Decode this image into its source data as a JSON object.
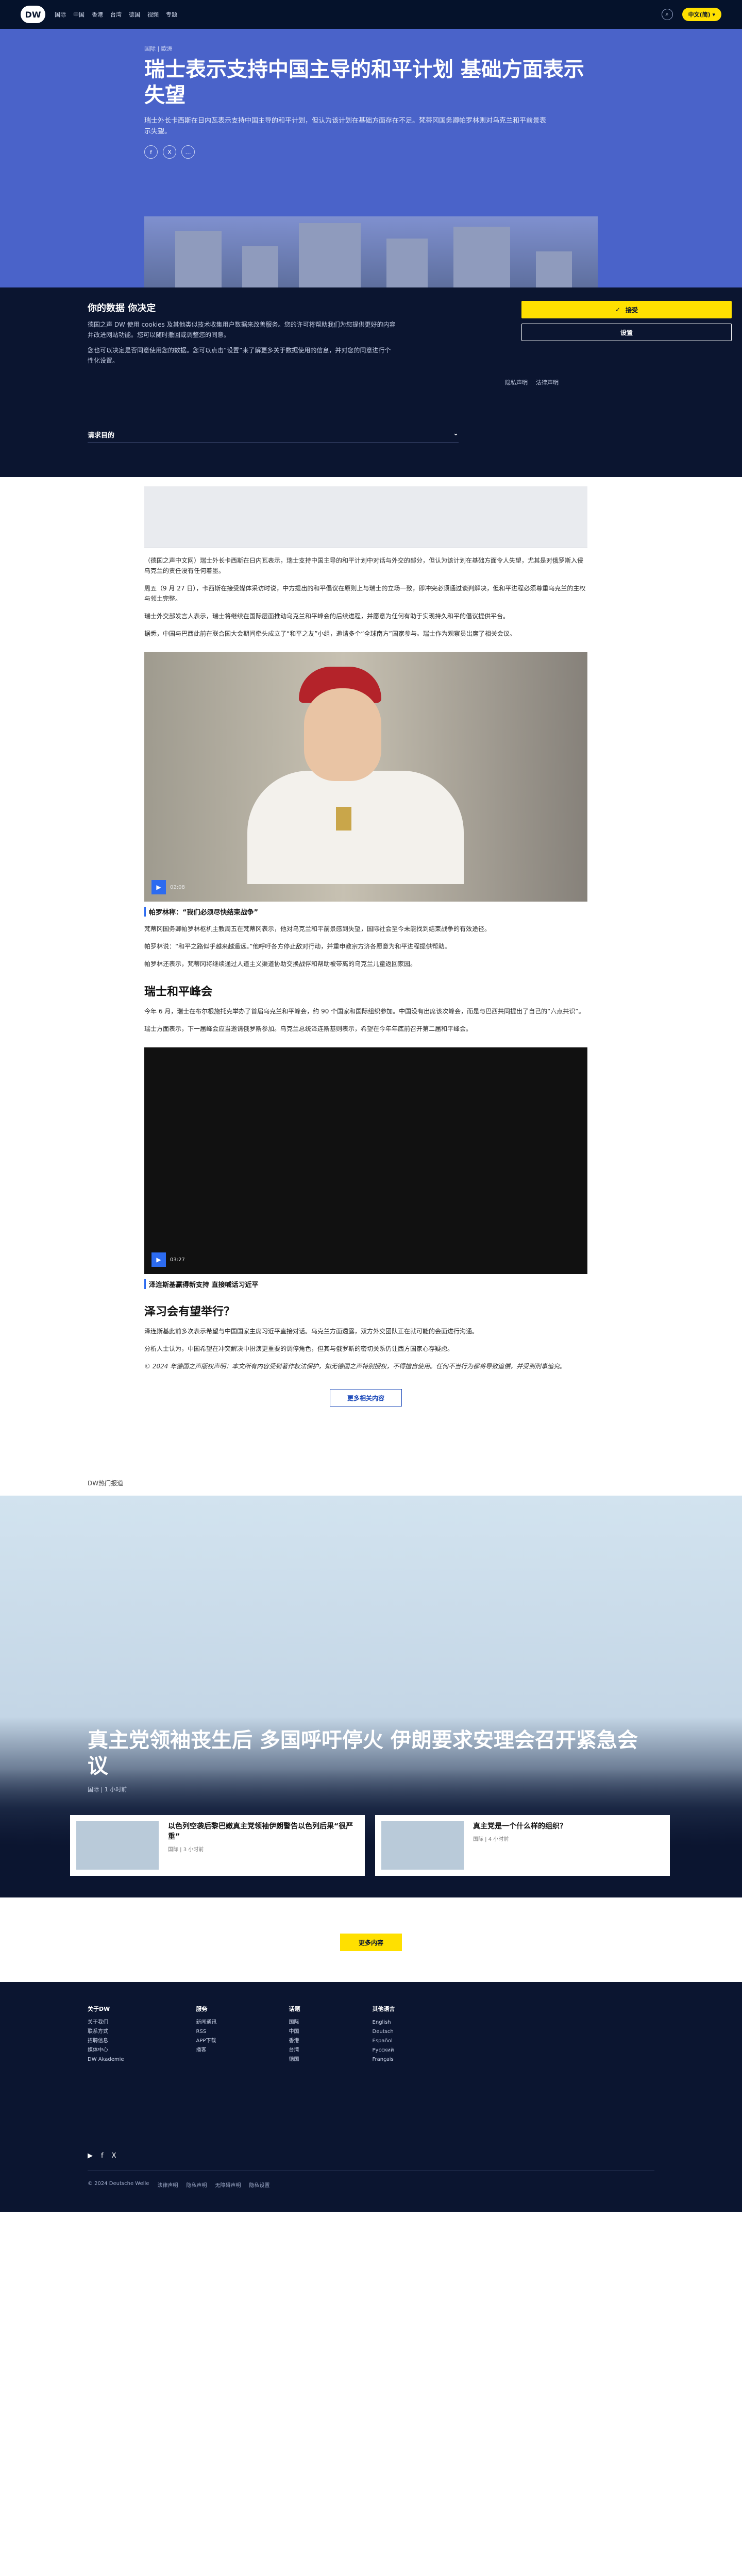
{
  "header": {
    "logo": "DW",
    "nav": [
      "国际",
      "中国",
      "香港",
      "台湾",
      "德国",
      "视频",
      "专题"
    ],
    "search_icon": "search-icon",
    "lang_button": "中文(简) ▾"
  },
  "hero": {
    "kicker": "国际 | 欧洲",
    "title": "瑞士表示支持中国主导的和平计划 基础方面表示失望",
    "lead": "瑞士外长卡西斯在日内瓦表示支持中国主导的和平计划，但认为该计划在基础方面存在不足。梵蒂冈国务卿帕罗林则对乌克兰和平前景表示失望。",
    "share": [
      "f",
      "X",
      "…"
    ]
  },
  "cookie": {
    "title": "你的数据 你决定",
    "text": "德国之声 DW 使用 cookies 及其他类似技术收集用户数据来改善服务。您的许可将帮助我们为您提供更好的内容并改进网站功能。您可以随时撤回或调整您的同意。",
    "text2": "您也可以决定是否同意使用您的数据。您可以点击“设置”来了解更多关于数据使用的信息，并对您的同意进行个性化设置。",
    "accept": "接受",
    "settings": "设置",
    "links": [
      "隐私声明",
      "法律声明"
    ],
    "purpose": "请求目的"
  },
  "article": {
    "ad_label": "",
    "p1": "（德国之声中文网）瑞士外长卡西斯在日内瓦表示，瑞士支持中国主导的和平计划中对话与外交的部分，但认为该计划在基础方面令人失望，尤其是对俄罗斯入侵乌克兰的责任没有任何着墨。",
    "p2": "周五（9 月 27 日），卡西斯在接受媒体采访时说，中方提出的和平倡议在原则上与瑞士的立场一致，即冲突必须通过谈判解决，但和平进程必须尊重乌克兰的主权与领土完整。",
    "p3": "瑞士外交部发言人表示，瑞士将继续在国际层面推动乌克兰和平峰会的后续进程，并愿意为任何有助于实现持久和平的倡议提供平台。",
    "p4": "据悉，中国与巴西此前在联合国大会期间牵头成立了“和平之友”小组，邀请多个“全球南方”国家参与。瑞士作为观察员出席了相关会议。",
    "video1_duration": "02:08",
    "caption1": "帕罗林称：“我们必须尽快结束战争”",
    "p5": "梵蒂冈国务卿帕罗林枢机主教周五在梵蒂冈表示，他对乌克兰和平前景感到失望，国际社会至今未能找到结束战争的有效途径。",
    "p6": "帕罗林说：“和平之路似乎越来越遥远。”他呼吁各方停止敌对行动，并重申教宗方济各愿意为和平进程提供帮助。",
    "p7": "帕罗林还表示，梵蒂冈将继续通过人道主义渠道协助交换战俘和帮助被带离的乌克兰儿童返回家园。",
    "h2a": "瑞士和平峰会",
    "p8": "今年 6 月，瑞士在布尔根施托克举办了首届乌克兰和平峰会，约 90 个国家和国际组织参加。中国没有出席该次峰会，而是与巴西共同提出了自己的“六点共识”。",
    "p9": "瑞士方面表示，下一届峰会应当邀请俄罗斯参加。乌克兰总统泽连斯基则表示，希望在今年年底前召开第二届和平峰会。",
    "video2_duration": "03:27",
    "caption2": "泽连斯基赢得新支持 直接喊话习近平",
    "h2b": "泽习会有望举行？",
    "p10": "泽连斯基此前多次表示希望与中国国家主席习近平直接对话。乌克兰方面透露，双方外交团队正在就可能的会面进行沟通。",
    "p11": "分析人士认为，中国希望在冲突解决中扮演更重要的调停角色，但其与俄罗斯的密切关系仍让西方国家心存疑虑。",
    "italic": "© 2024 年德国之声版权声明：本文所有内容受到著作权法保护，如无德国之声特别授权，不得擅自使用。任何不当行为都将导致追偿，并受到刑事追究。",
    "related_button": "更多相关内容"
  },
  "more": {
    "label": "DW热门报道",
    "feature_title": "真主党领袖丧生后 多国呼吁停火 伊朗要求安理会召开紧急会议",
    "feature_meta": "国际 | 1 小时前",
    "cards": [
      {
        "title": "以色列空袭后黎巴嫩真主党领袖伊朗警告以色列后果“很严重”",
        "meta": "国际 | 3 小时前"
      },
      {
        "title": "真主党是一个什么样的组织？",
        "meta": "国际 | 4 小时前"
      }
    ],
    "load_more": "更多内容"
  },
  "footer": {
    "columns": [
      {
        "head": "关于DW",
        "items": [
          "关于我们",
          "联系方式",
          "招聘信息",
          "媒体中心",
          "DW Akademie"
        ]
      },
      {
        "head": "服务",
        "items": [
          "新闻通讯",
          "RSS",
          "APP下载",
          "播客"
        ]
      },
      {
        "head": "话题",
        "items": [
          "国际",
          "中国",
          "香港",
          "台湾",
          "德国"
        ]
      },
      {
        "head": "其他语言",
        "items": [
          "English",
          "Deutsch",
          "Español",
          "Русский",
          "Français"
        ]
      }
    ],
    "social": [
      "▶",
      "f",
      "X"
    ],
    "legal": [
      "© 2024 Deutsche Welle",
      "法律声明",
      "隐私声明",
      "无障碍声明",
      "隐私设置"
    ]
  }
}
